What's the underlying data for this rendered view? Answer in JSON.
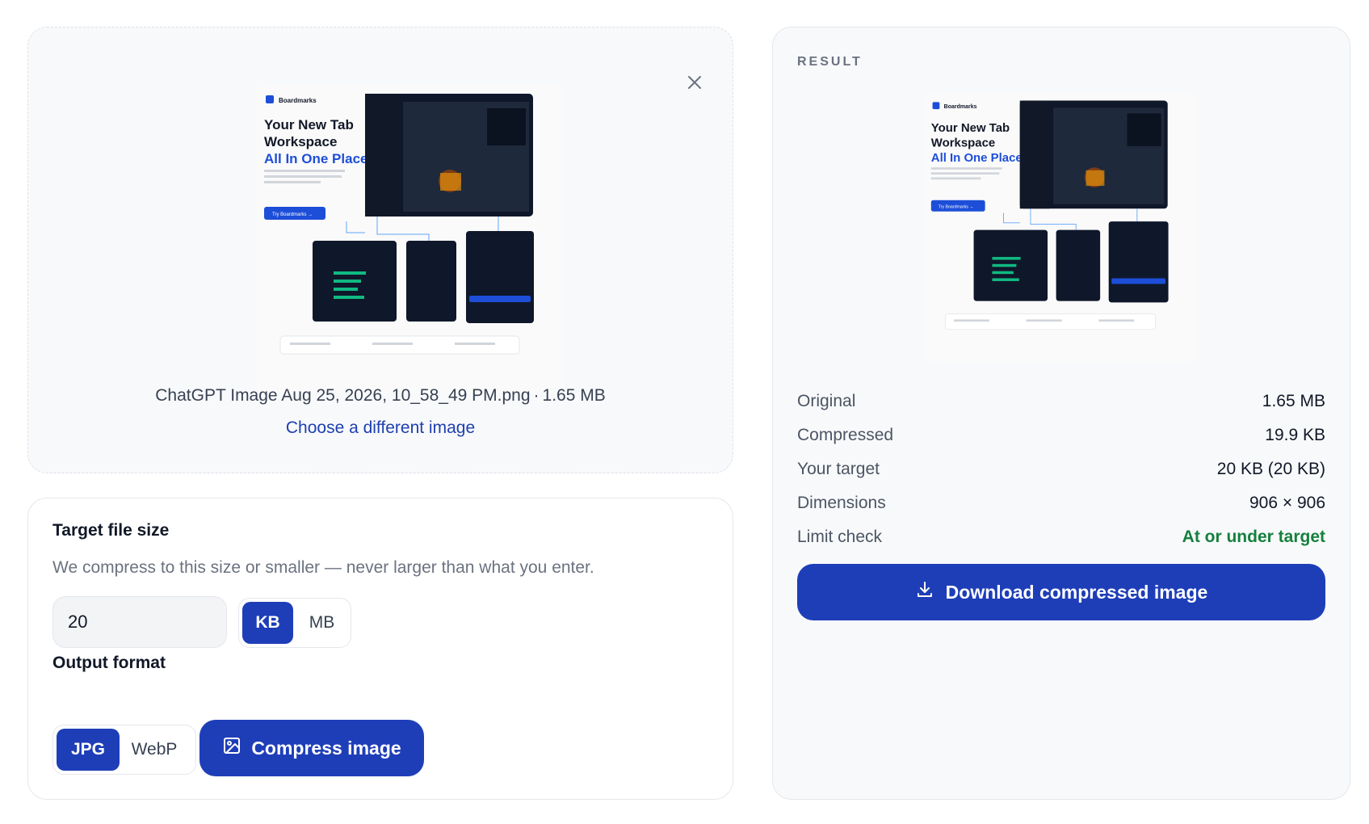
{
  "upload": {
    "file_name": "ChatGPT Image Aug 25, 2026, 10_58_49 PM.png",
    "separator": "·",
    "file_size": "1.65 MB",
    "choose_link": "Choose a different image",
    "close_icon": "close-icon"
  },
  "preview": {
    "brand": "Boardmarks",
    "headline_1": "Your New Tab",
    "headline_2": "Workspace",
    "headline_3": "All In One Place",
    "cta": "Try Boardmarks →"
  },
  "settings": {
    "target_label": "Target file size",
    "hint": "We compress to this size or smaller — never larger than what you enter.",
    "size_value": "20",
    "units": [
      "KB",
      "MB"
    ],
    "selected_unit": "KB",
    "format_label": "Output format",
    "formats": [
      "JPG",
      "WebP"
    ],
    "selected_format": "JPG",
    "compress_button": "Compress image"
  },
  "result": {
    "heading": "RESULT",
    "stats": [
      {
        "label": "Original",
        "value": "1.65 MB"
      },
      {
        "label": "Compressed",
        "value": "19.9 KB"
      },
      {
        "label": "Your target",
        "value": "20 KB (20 KB)"
      },
      {
        "label": "Dimensions",
        "value": "906 × 906"
      },
      {
        "label": "Limit check",
        "value": "At or under target"
      }
    ],
    "download_button": "Download compressed image"
  },
  "colors": {
    "accent": "#1e3eb8",
    "success": "#15803d",
    "link": "#1e40af"
  }
}
